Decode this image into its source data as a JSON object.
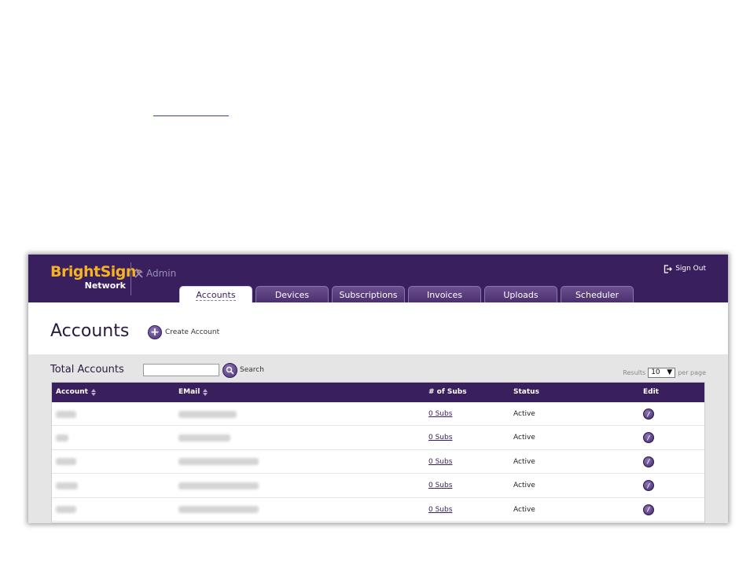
{
  "header": {
    "brand_name": "BrightSign",
    "brand_mark": "®",
    "brand_sub": "Network",
    "admin_label": "Admin",
    "admin_icon": "tools-icon",
    "signout_label": "Sign Out",
    "signout_icon": "sign-out-icon",
    "colors": {
      "bar": "#3a1f5e",
      "brand": "#f5b324"
    }
  },
  "tabs": [
    {
      "label": "Accounts",
      "active": true
    },
    {
      "label": "Devices",
      "active": false
    },
    {
      "label": "Subscriptions",
      "active": false
    },
    {
      "label": "Invoices",
      "active": false
    },
    {
      "label": "Uploads",
      "active": false
    },
    {
      "label": "Scheduler",
      "active": false
    }
  ],
  "page": {
    "title": "Accounts",
    "create_label": "Create Account",
    "create_icon": "plus-icon"
  },
  "toolbar": {
    "total_label": "Total Accounts",
    "search_value": "",
    "search_label": "Search",
    "search_icon": "magnifier-icon",
    "results_prefix": "Results",
    "results_value": "10",
    "results_suffix": "per page"
  },
  "table": {
    "columns": [
      "Account",
      "EMail",
      "# of Subs",
      "Status",
      "Edit"
    ],
    "rows": [
      {
        "subs": "0 Subs",
        "status": "Active"
      },
      {
        "subs": "0 Subs",
        "status": "Active"
      },
      {
        "subs": "0 Subs",
        "status": "Active"
      },
      {
        "subs": "0 Subs",
        "status": "Active"
      },
      {
        "subs": "0 Subs",
        "status": "Active"
      }
    ],
    "edit_icon": "pencil-icon"
  }
}
